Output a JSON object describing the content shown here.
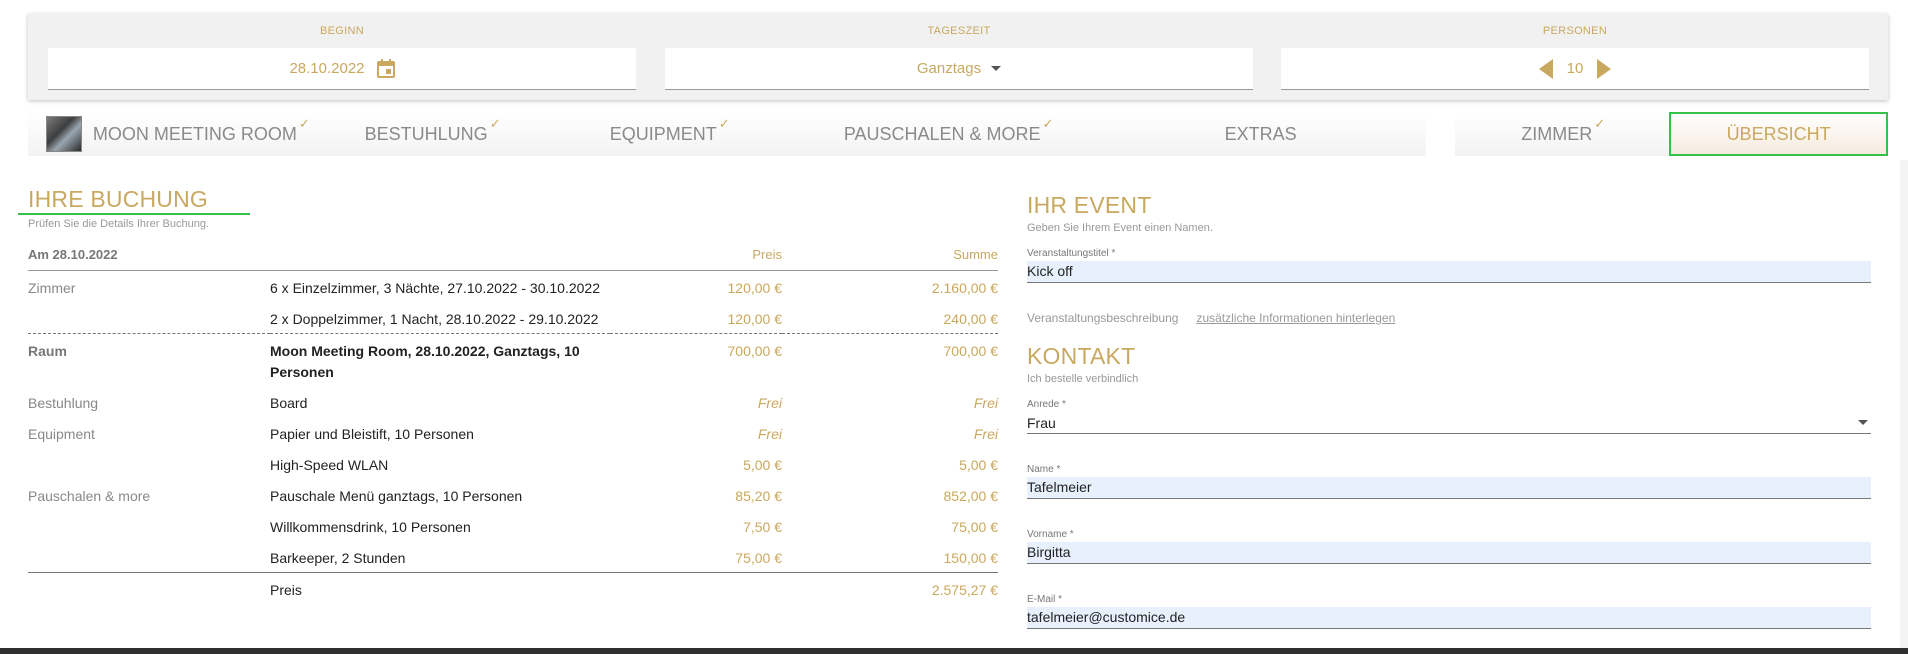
{
  "filters": {
    "beginn": {
      "label": "BEGINN",
      "value": "28.10.2022"
    },
    "tageszeit": {
      "label": "TAGESZEIT",
      "value": "Ganztags"
    },
    "personen": {
      "label": "PERSONEN",
      "value": "10"
    }
  },
  "tabs": [
    {
      "label": "MOON MEETING ROOM",
      "checked": "✓"
    },
    {
      "label": "BESTUHLUNG",
      "checked": "✓"
    },
    {
      "label": "EQUIPMENT",
      "checked": "✓"
    },
    {
      "label": "PAUSCHALEN & MORE",
      "checked": "✓"
    },
    {
      "label": "EXTRAS",
      "checked": ""
    },
    {
      "label": "ZIMMER",
      "checked": "✓"
    },
    {
      "label": "ÜBERSICHT",
      "checked": ""
    }
  ],
  "booking": {
    "title": "IHRE BUCHUNG",
    "hint": "Prüfen Sie die Details Ihrer Buchung.",
    "date_header": "Am 28.10.2022",
    "price_header": "Preis",
    "total_header": "Summe",
    "rows": [
      {
        "cat": "Zimmer",
        "desc": "6 x Einzelzimmer, 3 Nächte, 27.10.2022 - 30.10.2022",
        "price": "120,00 €",
        "total": "2.160,00 €"
      },
      {
        "cat": "",
        "desc": "2 x Doppelzimmer, 1 Nacht, 28.10.2022 - 29.10.2022",
        "price": "120,00 €",
        "total": "240,00 €"
      },
      {
        "cat": "Raum",
        "desc": "Moon Meeting Room, 28.10.2022, Ganztags, 10 Personen",
        "price": "700,00 €",
        "total": "700,00 €"
      },
      {
        "cat": "Bestuhlung",
        "desc": "Board",
        "price": "Frei",
        "total": "Frei"
      },
      {
        "cat": "Equipment",
        "desc": "Papier und Bleistift, 10 Personen",
        "price": "Frei",
        "total": "Frei"
      },
      {
        "cat": "",
        "desc": "High-Speed WLAN",
        "price": "5,00 €",
        "total": "5,00 €"
      },
      {
        "cat": "Pauschalen & more",
        "desc": "Pauschale Menü ganztags, 10 Personen",
        "price": "85,20 €",
        "total": "852,00 €"
      },
      {
        "cat": "",
        "desc": "Willkommensdrink, 10 Personen",
        "price": "7,50 €",
        "total": "75,00 €"
      },
      {
        "cat": "",
        "desc": "Barkeeper, 2 Stunden",
        "price": "75,00 €",
        "total": "150,00 €"
      },
      {
        "cat": "",
        "desc": "Preis",
        "price": "",
        "total": "2.575,27 €"
      }
    ]
  },
  "event": {
    "title": "IHR EVENT",
    "hint": "Geben Sie Ihrem Event einen Namen.",
    "title_label": "Veranstaltungstitel *",
    "title_value": "Kick off",
    "desc_label": "Veranstaltungsbeschreibung",
    "desc_link": "zusätzliche Informationen hinterlegen"
  },
  "contact": {
    "title": "KONTAKT",
    "hint": "Ich bestelle verbindlich",
    "anrede_label": "Anrede *",
    "anrede_value": "Frau",
    "name_label": "Name *",
    "name_value": "Tafelmeier",
    "vorname_label": "Vorname *",
    "vorname_value": "Birgitta",
    "email_label": "E-Mail *",
    "email_value": "tafelmeier@customice.de"
  },
  "colors": {
    "accent": "#c9a85f",
    "highlight": "#35c24a"
  }
}
